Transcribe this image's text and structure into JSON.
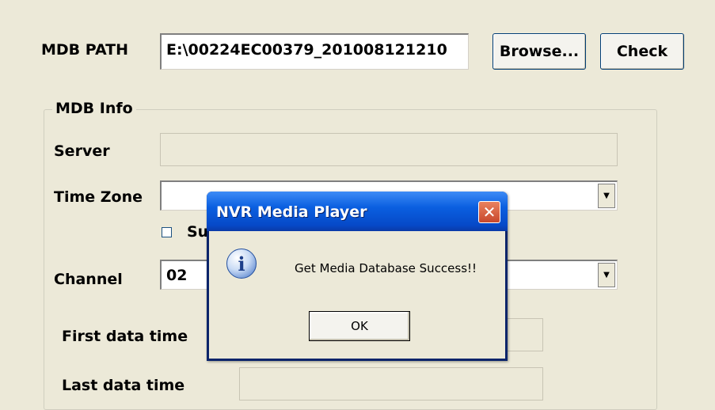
{
  "form": {
    "mdb_path_label": "MDB PATH",
    "mdb_path_value": "E:\\00224EC00379_201008121210",
    "browse_label": "Browse...",
    "check_label": "Check",
    "group_title": "MDB Info",
    "server_label": "Server",
    "timezone_label": "Time Zone",
    "checkbox_label_partial": "Su",
    "channel_label": "Channel",
    "channel_value": "02",
    "first_data_time_label": "First data time",
    "last_data_time_label": "Last data time"
  },
  "dialog": {
    "title": "NVR Media Player",
    "message": "Get Media Database Success!!",
    "ok_label": "OK",
    "icon": "info-icon"
  }
}
